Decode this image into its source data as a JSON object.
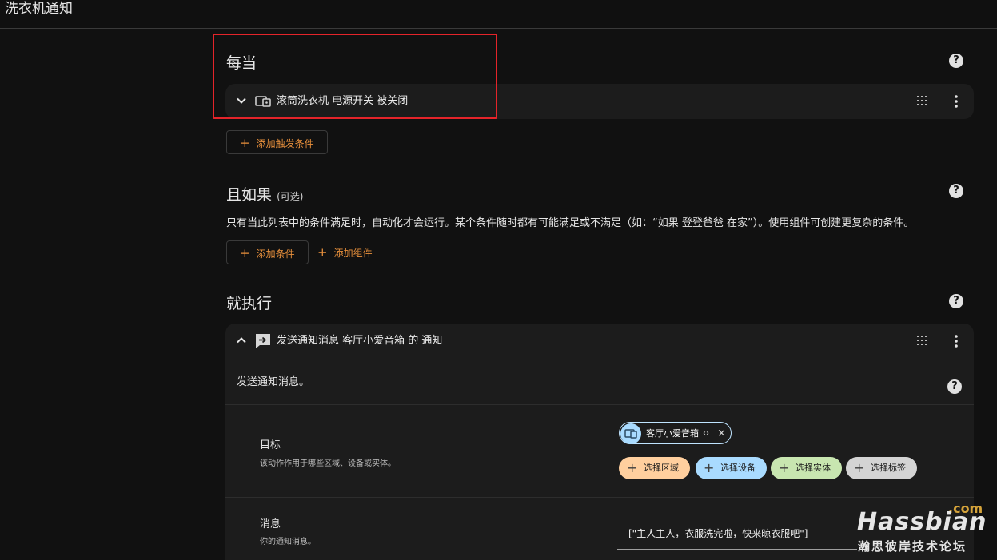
{
  "window": {
    "title": "洗衣机通知"
  },
  "triggers": {
    "heading": "每当",
    "item_label": "滚筒洗衣机 电源开关 被关闭",
    "add_label": "添加触发条件"
  },
  "conditions": {
    "heading": "且如果",
    "optional": "(可选)",
    "description": "只有当此列表中的条件满足时，自动化才会运行。某个条件随时都有可能满足或不满足（如：“如果 登登爸爸 在家”）。使用组件可创建更复杂的条件。",
    "add_condition_label": "添加条件",
    "add_block_label": "添加组件"
  },
  "actions": {
    "heading": "就执行",
    "item_label": "发送通知消息 客厅小爱音箱 的 通知",
    "description": "发送通知消息。",
    "target": {
      "title": "目标",
      "subtitle": "该动作作用于哪些区域、设备或实体。",
      "selected_chip": "客厅小爱音箱",
      "chip_code_icon": "‹›",
      "chip_close_icon": "×",
      "pickers": [
        {
          "label": "选择区域",
          "color": "#ffcf9e"
        },
        {
          "label": "选择设备",
          "color": "#a9dbff"
        },
        {
          "label": "选择实体",
          "color": "#c8e6b0"
        },
        {
          "label": "选择标签",
          "color": "#d4d4d4"
        }
      ]
    },
    "message": {
      "title": "消息",
      "subtitle": "你的通知消息。",
      "value": "[\"主人主人，衣服洗完啦，快来晾衣服吧\"]"
    }
  },
  "help_glyph": "?",
  "plus_glyph": "+",
  "watermark": {
    "main": "Hassbian",
    "com": ".com",
    "sub": "瀚思彼岸技术论坛"
  },
  "colors": {
    "accent": "#e8903c",
    "highlight": "#e4242a",
    "card": "#1c1c1c",
    "background": "#111111"
  }
}
